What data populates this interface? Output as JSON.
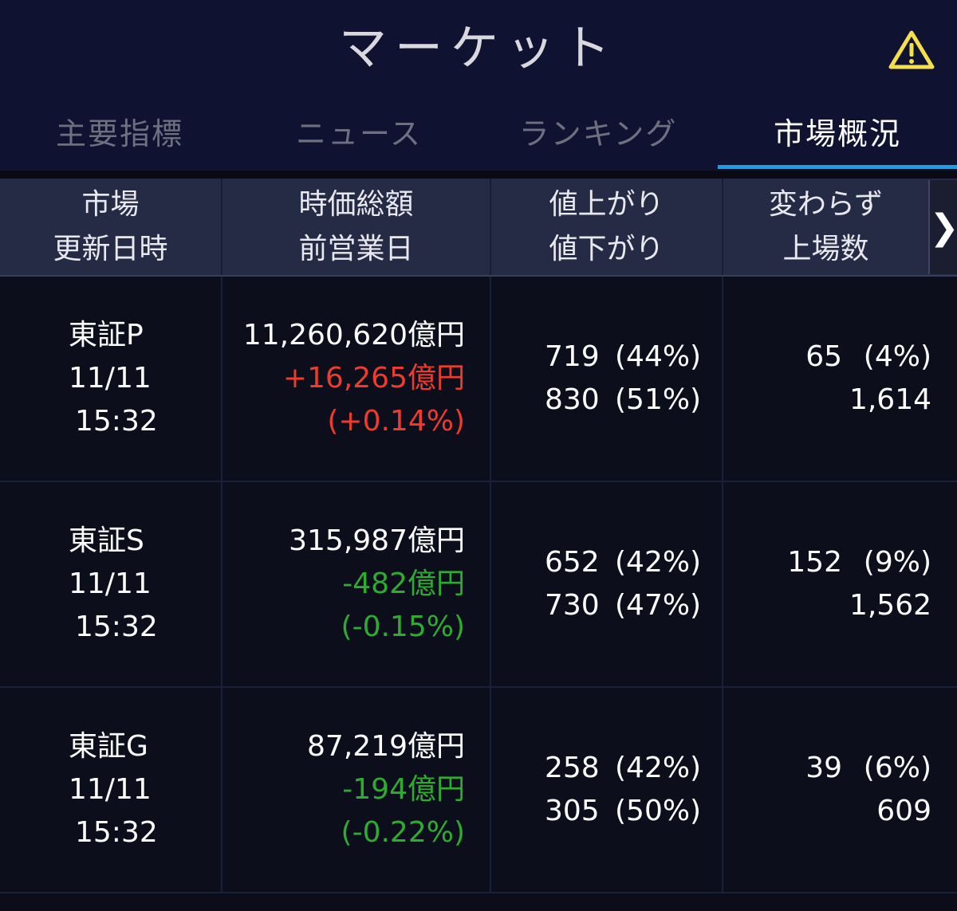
{
  "header": {
    "title": "マーケット",
    "warning_icon": "warning-triangle-icon"
  },
  "tabs": [
    {
      "label": "主要指標",
      "active": false
    },
    {
      "label": "ニュース",
      "active": false
    },
    {
      "label": "ランキング",
      "active": false
    },
    {
      "label": "市場概況",
      "active": true
    }
  ],
  "columns": [
    {
      "line1": "市場",
      "line2": "更新日時"
    },
    {
      "line1": "時価総額",
      "line2": "前営業日"
    },
    {
      "line1": "値上がり",
      "line2": "値下がり"
    },
    {
      "line1": "変わらず",
      "line2": "上場数"
    }
  ],
  "next_button": "❯",
  "rows": [
    {
      "market": "東証P",
      "date": "11/11",
      "time": "15:32",
      "cap": "11,260,620億円",
      "change": "+16,265億円",
      "change_pct": "(+0.14%)",
      "direction": "up",
      "adv_count": "719",
      "adv_pct": "(44%)",
      "dec_count": "830",
      "dec_pct": "(51%)",
      "unch_count": "65",
      "unch_pct": "(4%)",
      "listed": "1,614"
    },
    {
      "market": "東証S",
      "date": "11/11",
      "time": "15:32",
      "cap": "315,987億円",
      "change": "-482億円",
      "change_pct": "(-0.15%)",
      "direction": "down",
      "adv_count": "652",
      "adv_pct": "(42%)",
      "dec_count": "730",
      "dec_pct": "(47%)",
      "unch_count": "152",
      "unch_pct": "(9%)",
      "listed": "1,562"
    },
    {
      "market": "東証G",
      "date": "11/11",
      "time": "15:32",
      "cap": "87,219億円",
      "change": "-194億円",
      "change_pct": "(-0.22%)",
      "direction": "down",
      "adv_count": "258",
      "adv_pct": "(42%)",
      "dec_count": "305",
      "dec_pct": "(50%)",
      "unch_count": "39",
      "unch_pct": "(6%)",
      "listed": "609"
    }
  ],
  "colors": {
    "up": "#ee3b2c",
    "down": "#2dac2f",
    "accent": "#1e9be6",
    "warning": "#f4e04d"
  }
}
